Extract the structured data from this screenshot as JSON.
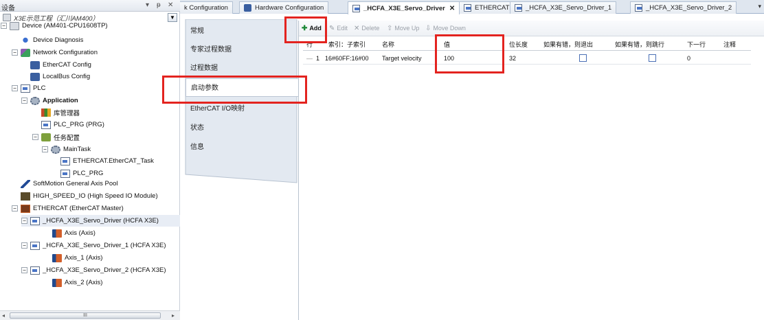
{
  "left_panel": {
    "title": "设备",
    "header_controls": [
      "▾",
      "ᵽ",
      "✕"
    ],
    "root_label": "X3E示范工程（汇川AM400）",
    "tree": [
      {
        "label": "Device (AM401-CPU1608TP)",
        "icon": "device-icon",
        "expander": "−"
      },
      {
        "label": "Device Diagnosis",
        "icon": "diagnosis-icon"
      },
      {
        "label": "Network Configuration",
        "icon": "network-icon",
        "expander": "−"
      },
      {
        "label": "EtherCAT Config",
        "icon": "plug-icon"
      },
      {
        "label": "LocalBus Config",
        "icon": "plug-icon"
      },
      {
        "label": "PLC",
        "icon": "plc-icon",
        "expander": "−"
      },
      {
        "label": "Application",
        "icon": "gear-icon",
        "expander": "−",
        "bold": true
      },
      {
        "label": "库管理器",
        "icon": "library-icon"
      },
      {
        "label": "PLC_PRG (PRG)",
        "icon": "program-icon"
      },
      {
        "label": "任务配置",
        "icon": "task-config-icon",
        "expander": "−"
      },
      {
        "label": "MainTask",
        "icon": "task-icon",
        "expander": "−"
      },
      {
        "label": "ETHERCAT.EtherCAT_Task",
        "icon": "program-icon"
      },
      {
        "label": "PLC_PRG",
        "icon": "program-icon"
      },
      {
        "label": "SoftMotion General Axis Pool",
        "icon": "motion-icon"
      },
      {
        "label": "HIGH_SPEED_IO (High Speed IO Module)",
        "icon": "io-module-icon"
      },
      {
        "label": "ETHERCAT (EtherCAT Master)",
        "icon": "ethercat-master-icon",
        "expander": "−"
      },
      {
        "label": "_HCFA_X3E_Servo_Driver (HCFA X3E)",
        "icon": "servo-icon",
        "expander": "−"
      },
      {
        "label": "Axis (Axis)",
        "icon": "axis-icon"
      },
      {
        "label": "_HCFA_X3E_Servo_Driver_1 (HCFA X3E)",
        "icon": "servo-icon",
        "expander": "−"
      },
      {
        "label": "Axis_1 (Axis)",
        "icon": "axis-icon"
      },
      {
        "label": "_HCFA_X3E_Servo_Driver_2 (HCFA X3E)",
        "icon": "servo-icon",
        "expander": "−"
      },
      {
        "label": "Axis_2 (Axis)",
        "icon": "axis-icon"
      }
    ],
    "scroll_thumb": "III"
  },
  "tabs": [
    {
      "label": "k Configuration"
    },
    {
      "label": "Hardware Configuration"
    },
    {
      "label": "_HCFA_X3E_Servo_Driver",
      "active": true,
      "close": "✕"
    },
    {
      "label": "ETHERCAT"
    },
    {
      "label": "_HCFA_X3E_Servo_Driver_1"
    },
    {
      "label": "_HCFA_X3E_Servo_Driver_2"
    }
  ],
  "tab_overflow": "▾",
  "categories": [
    {
      "label": "常规"
    },
    {
      "label": "专家过程数据"
    },
    {
      "label": "过程数据"
    },
    {
      "label": "启动参数",
      "active": true
    },
    {
      "label": "EtherCAT I/O映射"
    },
    {
      "label": "状态"
    },
    {
      "label": "信息"
    }
  ],
  "toolbar": {
    "add": "Add",
    "edit": "Edit",
    "delete": "Delete",
    "move_up": "Move Up",
    "move_down": "Move Down",
    "icons": {
      "add": "✚",
      "edit": "✎",
      "delete": "✕",
      "move_up": "⇧",
      "move_down": "⇩"
    }
  },
  "grid": {
    "columns": [
      "行",
      "索引：子索引",
      "名称",
      "值",
      "位长度",
      "如果有错，则退出",
      "如果有错，则跳行",
      "下一行",
      "注释"
    ],
    "rows": [
      {
        "row": "1",
        "index": "16#60FF:16#00",
        "name": "Target velocity",
        "value": "100",
        "bit_length": "32",
        "exit_on_error": false,
        "jump_on_error": false,
        "next_line": "0",
        "comment": "",
        "row_marker": "—"
      }
    ]
  },
  "colors": {
    "highlight": "#e3231f",
    "accent": "#4a6fb5"
  }
}
